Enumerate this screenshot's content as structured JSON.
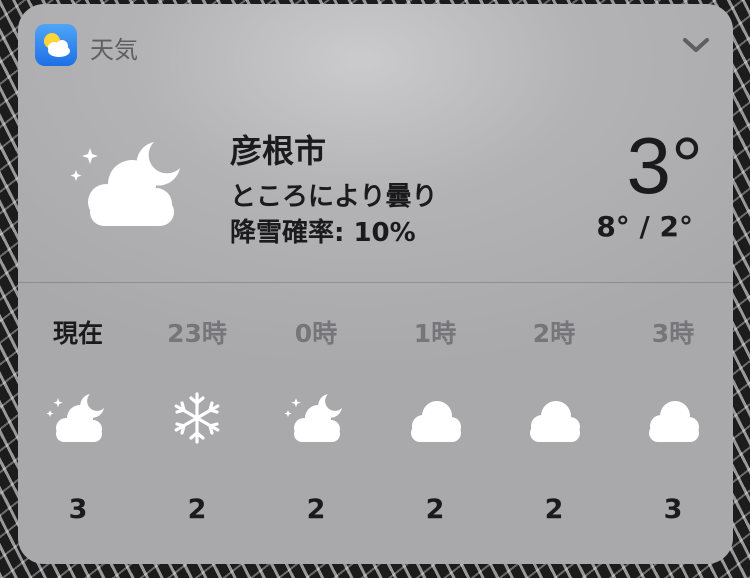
{
  "app": {
    "name": "天気",
    "icon": "weather-app-icon"
  },
  "current": {
    "city": "彦根市",
    "condition": "ところにより曇り",
    "precipitation": "降雪確率: 10%",
    "temperature": "3°",
    "high_low": "8° / 2°",
    "icon": "partly-cloudy-night-icon"
  },
  "hourly": [
    {
      "time": "現在",
      "icon": "partly-cloudy-night-icon",
      "temp": "3"
    },
    {
      "time": "23時",
      "icon": "snowflake-icon",
      "temp": "2"
    },
    {
      "time": "0時",
      "icon": "partly-cloudy-night-icon",
      "temp": "2"
    },
    {
      "time": "1時",
      "icon": "cloud-icon",
      "temp": "2"
    },
    {
      "time": "2時",
      "icon": "cloud-icon",
      "temp": "2"
    },
    {
      "time": "3時",
      "icon": "cloud-icon",
      "temp": "3"
    }
  ]
}
